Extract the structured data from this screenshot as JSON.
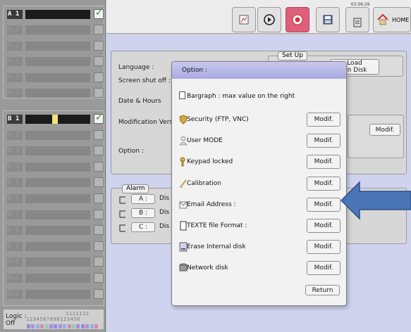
{
  "channels_a": [
    {
      "tag": "A 1",
      "active": true
    },
    {
      "tag": "A 2",
      "active": false
    },
    {
      "tag": "A 3",
      "active": false
    },
    {
      "tag": "A 4",
      "active": false
    },
    {
      "tag": "A 5",
      "active": false
    },
    {
      "tag": "A 6",
      "active": false
    }
  ],
  "channels_b": [
    {
      "tag": "B 1",
      "active": true
    },
    {
      "tag": "B 2",
      "active": false
    },
    {
      "tag": "B 3",
      "active": false
    },
    {
      "tag": "B 4",
      "active": false
    },
    {
      "tag": "B 5",
      "active": false
    },
    {
      "tag": "B 6",
      "active": false
    },
    {
      "tag": "B 7",
      "active": false
    },
    {
      "tag": "B 8",
      "active": false
    },
    {
      "tag": "B 9",
      "active": false
    },
    {
      "tag": "B10",
      "active": false
    },
    {
      "tag": "B11",
      "active": false
    },
    {
      "tag": "B12",
      "active": false
    }
  ],
  "logic": {
    "label_top": "Logic :",
    "label_bottom": "Off",
    "digits_top": "1111111",
    "digits_bottom": "1234567890123456"
  },
  "toolbar": {
    "clock": "03:39:29",
    "home_label": "HOME",
    "buttons": [
      "setup-icon",
      "play-icon",
      "record-icon",
      "save-disk-icon",
      "device-icon",
      "home-icon"
    ]
  },
  "settings": {
    "language_label": "Language :",
    "screen_shut_off_label": "Screen shut off :",
    "date_hours_label": "Date & Hours",
    "modification_version_label": "Modification Vers",
    "option_label": "Option :",
    "setup_tag": "Set Up",
    "load_on_disk_line1": "Load",
    "load_on_disk_line2": "On Disk",
    "modif_label": "Modif."
  },
  "alarm": {
    "tag": "Alarm",
    "rows": [
      {
        "letter": "A :",
        "status": "Dis"
      },
      {
        "letter": "B :",
        "status": "Dis"
      },
      {
        "letter": "C :",
        "status": "Dis"
      }
    ]
  },
  "dialog": {
    "title": "Option :",
    "bargraph_label": "Bargraph : max value on the right",
    "options": [
      {
        "label": "Security (FTP, VNC)",
        "button": "Modif.",
        "icon": "shield-icon"
      },
      {
        "label": "User MODE",
        "button": "Modif.",
        "icon": "user-icon"
      },
      {
        "label": "Keypad locked",
        "button": "Modif.",
        "icon": "key-icon"
      },
      {
        "label": "Calibration",
        "button": "Modif.",
        "icon": "calibration-icon"
      },
      {
        "label": "Email Address :",
        "button": "Modif.",
        "icon": "email-icon"
      },
      {
        "label": "TEXTE file Format :",
        "button": "Modif.",
        "icon": "text-file-icon"
      },
      {
        "label": "Erase Internal disk",
        "button": "Modif.",
        "icon": "disk-icon"
      },
      {
        "label": "Network disk",
        "button": "Modif.",
        "icon": "network-disk-icon"
      }
    ],
    "return_label": "Return"
  },
  "colors": {
    "dialog_header": "#b3b3e6",
    "main_background": "#cfd3ee",
    "record_button": "#e0607c",
    "arrow": "#4a76b8",
    "active_marker": "#f3e37a"
  }
}
